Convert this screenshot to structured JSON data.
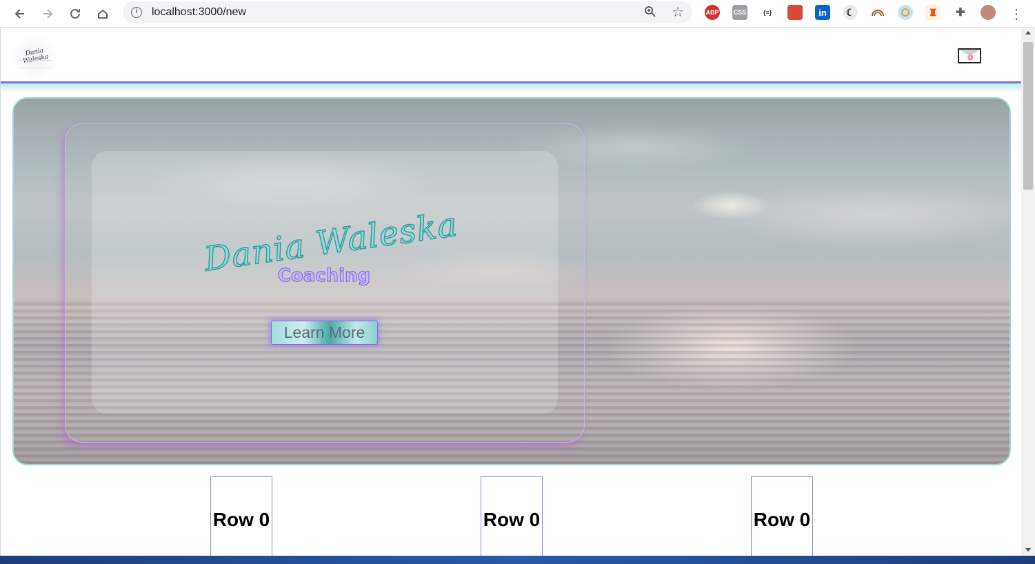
{
  "browser": {
    "url": "localhost:3000/new",
    "extensions": [
      {
        "name": "adblock-plus-icon",
        "label": "ABP",
        "color": "#d32f2f"
      },
      {
        "name": "css-viewer-icon",
        "label": "CSS",
        "color": "#9aa0a6"
      },
      {
        "name": "json-formatter-icon",
        "label": "{≡}",
        "color": "#ffffff"
      },
      {
        "name": "extension-red-icon",
        "label": "",
        "color": "#d84a38"
      },
      {
        "name": "linkedin-icon",
        "label": "in",
        "color": "#0a66c2"
      },
      {
        "name": "dark-mode-icon",
        "label": "",
        "color": "#5f6368"
      },
      {
        "name": "rainbow-icon",
        "label": "",
        "color": "#ffffff"
      },
      {
        "name": "eye-dropper-icon",
        "label": "",
        "color": "#8ecae6"
      },
      {
        "name": "figure-icon",
        "label": "",
        "color": "#ff7043"
      },
      {
        "name": "puzzle-icon",
        "label": "",
        "color": "#5f6368"
      },
      {
        "name": "profile-avatar-icon",
        "label": "",
        "color": "#c08a7a"
      }
    ]
  },
  "site": {
    "logo_text": "Dania Waleska",
    "hero": {
      "title": "Dania Waleska",
      "subtitle": "Coaching",
      "cta_label": "Learn More"
    },
    "rows": [
      {
        "label": "Row 0"
      },
      {
        "label": "Row 0"
      },
      {
        "label": "Row 0"
      }
    ]
  },
  "colors": {
    "accent_purple": "#7b6ee0",
    "accent_teal": "#2f9e9a",
    "subtitle_lavender": "#c6b8ff"
  }
}
